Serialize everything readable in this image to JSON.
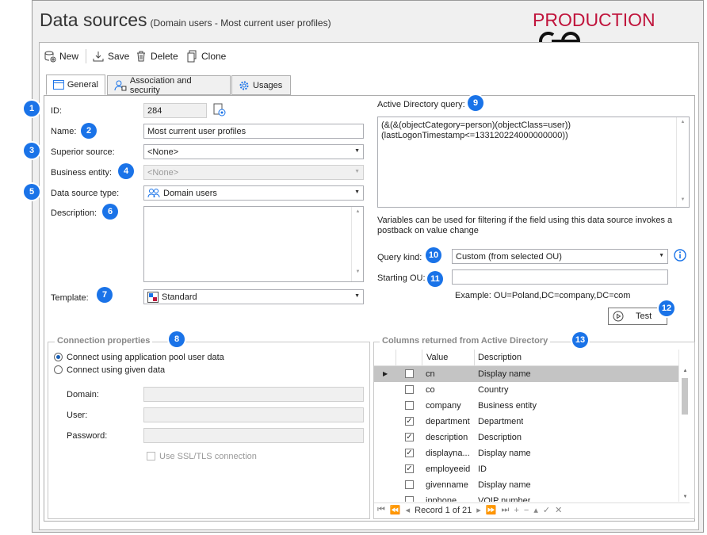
{
  "header": {
    "title": "Data sources",
    "subtitle": "(Domain users - Most current user profiles)",
    "brand": "PRODUCTION"
  },
  "toolbar": {
    "new_label": "New",
    "save_label": "Save",
    "delete_label": "Delete",
    "clone_label": "Clone"
  },
  "tabs": [
    {
      "label": "General",
      "icon": "form-icon",
      "active": true
    },
    {
      "label": "Association and security",
      "icon": "users-lock-icon",
      "active": false
    },
    {
      "label": "Usages",
      "icon": "gear-icon",
      "active": false
    }
  ],
  "form": {
    "id_label": "ID:",
    "id_value": "284",
    "name_label": "Name:",
    "name_value": "Most current user profiles",
    "superior_label": "Superior source:",
    "superior_value": "<None>",
    "business_label": "Business entity:",
    "business_value": "<None>",
    "type_label": "Data source type:",
    "type_value": "Domain users",
    "description_label": "Description:",
    "description_value": "",
    "template_label": "Template:",
    "template_value": "Standard"
  },
  "ad": {
    "query_label": "Active Directory query:",
    "query_line1": "(&(&(objectCategory=person)(objectClass=user))",
    "query_line2": "(lastLogonTimestamp<=133120224000000000))",
    "hint_line1": "Variables can be used for filtering if the field using this data source invokes a",
    "hint_line2": "postback on value change",
    "query_kind_label": "Query kind:",
    "query_kind_value": "Custom (from selected OU)",
    "starting_ou_label": "Starting OU:",
    "starting_ou_value": "",
    "example": "Example: OU=Poland,DC=company,DC=com",
    "test_label": "Test"
  },
  "connection": {
    "title": "Connection properties",
    "opt1": "Connect using application pool user data",
    "opt2": "Connect using given data",
    "domain_label": "Domain:",
    "user_label": "User:",
    "password_label": "Password:",
    "ssl_label": "Use SSL/TLS connection"
  },
  "columns": {
    "title": "Columns returned from Active Directory",
    "headers": [
      "Value",
      "Description"
    ],
    "rows": [
      {
        "value": "cn",
        "description": "Display name",
        "checked": false,
        "selected": true
      },
      {
        "value": "co",
        "description": "Country",
        "checked": false,
        "selected": false
      },
      {
        "value": "company",
        "description": "Business entity",
        "checked": false,
        "selected": false
      },
      {
        "value": "department",
        "description": "Department",
        "checked": true,
        "selected": false
      },
      {
        "value": "description",
        "description": "Description",
        "checked": true,
        "selected": false
      },
      {
        "value": "displayna...",
        "description": "Display name",
        "checked": true,
        "selected": false
      },
      {
        "value": "employeeid",
        "description": "ID",
        "checked": true,
        "selected": false
      },
      {
        "value": "givenname",
        "description": "Display name",
        "checked": false,
        "selected": false
      },
      {
        "value": "ipphone",
        "description": "VOIP number",
        "checked": false,
        "selected": false
      }
    ],
    "pager": "Record 1 of 21"
  },
  "badges": [
    "1",
    "2",
    "3",
    "4",
    "5",
    "6",
    "7",
    "8",
    "9",
    "10",
    "11",
    "12",
    "13"
  ],
  "colors": {
    "accent": "#1a73e8",
    "brand": "#c0143c"
  }
}
